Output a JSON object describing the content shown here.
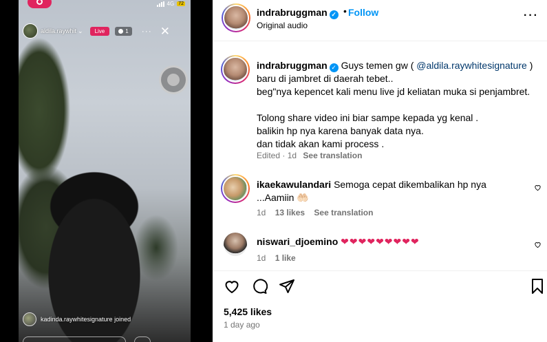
{
  "video": {
    "status_network": "4G",
    "status_battery": "72",
    "live_handle": "aldila.raywhit",
    "live_badge": "Live",
    "viewer_count": "1",
    "joined_text": "kadinda.raywhitesignature joined"
  },
  "header": {
    "username": "indrabruggman",
    "dot": "•",
    "follow_label": "Follow",
    "audio_label": "Original audio",
    "more": "···"
  },
  "caption": {
    "username": "indrabruggman",
    "text_before_mention": "Guys temen gw (",
    "mention": "@aldila.raywhitesignature",
    "text_after_mention": ")",
    "lines": [
      "baru di jambret di daerah tebet..",
      "beg\"nya kepencet kali menu live jd keliatan muka si penjambret.",
      "",
      "Tolong share video ini biar sampe kepada yg kenal .",
      "balikin hp nya karena banyak data nya.",
      "dan tidak akan kami process ."
    ],
    "meta_edited": "Edited · 1d",
    "meta_see_translation": "See translation"
  },
  "comments": [
    {
      "username": "ikaekawulandari",
      "text": "Semoga cepat dikembalikan hp nya ...Aamiin 🤲🏻",
      "time": "1d",
      "likes": "13 likes",
      "see_translation": "See translation"
    },
    {
      "username": "niswari_djoemino",
      "text": "❤❤❤❤❤❤❤❤❤",
      "time": "1d",
      "likes": "1 like"
    }
  ],
  "actions": {
    "likes_count": "5,425 likes",
    "time_ago": "1 day ago"
  },
  "colors": {
    "accent": "#0095f6",
    "live": "#e0245e",
    "muted": "#737373",
    "mention": "#00376b"
  }
}
